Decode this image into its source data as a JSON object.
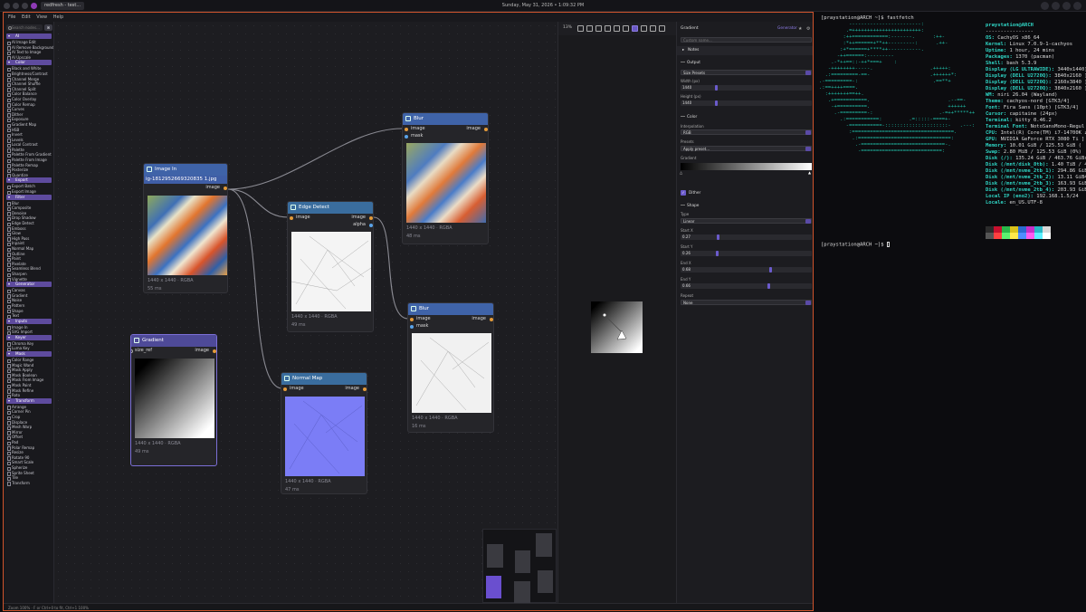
{
  "taskbar": {
    "tab": "redfresh - test...",
    "clock": "Sunday, May 31, 2026 • 1:09:32 PM"
  },
  "menu": [
    "File",
    "Edit",
    "View",
    "Help"
  ],
  "sidebar": {
    "search_placeholder": "Search nodes...",
    "search_btn": "⌘",
    "categories": [
      {
        "name": "AI",
        "items": [
          "AI Image Edit",
          "AI Remove Background",
          "AI Text to Image",
          "AI Upscale"
        ]
      },
      {
        "name": "Color",
        "items": [
          "Black and White",
          "Brightness/Contrast",
          "Channel Merge",
          "Channel Shuffle",
          "Channel Split",
          "Color Balance",
          "Color Overlay",
          "Color Remap",
          "Curves",
          "Dither",
          "Exposure",
          "Gradient Map",
          "HSB",
          "Invert",
          "Levels",
          "Local Contrast",
          "Palette",
          "Palette From Gradient",
          "Palette From Image",
          "Palette Remap",
          "Posterize",
          "Quantize"
        ]
      },
      {
        "name": "Export",
        "items": [
          "Export Batch",
          "Export Image"
        ]
      },
      {
        "name": "Filter",
        "items": [
          "Blur",
          "Composite",
          "Denoise",
          "Drop Shadow",
          "Edge Detect",
          "Emboss",
          "Glow",
          "High Pass",
          "Inpaint",
          "Normal Map",
          "Outline",
          "Paint",
          "Pixelate",
          "Seamless Blend",
          "Sharpen",
          "Vignette"
        ]
      },
      {
        "name": "Generator",
        "items": [
          "Canvas",
          "Gradient",
          "Noise",
          "Pattern",
          "Shape",
          "Text"
        ]
      },
      {
        "name": "Inputs",
        "items": [
          "Image In",
          "SVG Import"
        ]
      },
      {
        "name": "Keyer",
        "items": [
          "Chroma Key",
          "Luma Key"
        ]
      },
      {
        "name": "Mask",
        "items": [
          "Color Range",
          "Magic Wand",
          "Mask Apply",
          "Mask Boolean",
          "Mask From Image",
          "Mask Paint",
          "Mask Refine",
          "Roto"
        ]
      },
      {
        "name": "Transform",
        "items": [
          "Arrange",
          "Corner Pin",
          "Crop",
          "Displace",
          "Mesh Warp",
          "Mirror",
          "Offset",
          "Pad",
          "Polar Remap",
          "Resize",
          "Rotate 90",
          "Smart Scale",
          "Spherize",
          "Sprite Sheet",
          "Tile",
          "Transform"
        ]
      }
    ]
  },
  "status": "Zoom 100% · F or Ctrl+0 to fit, Ctrl+1 100%",
  "nodes": {
    "image_in": {
      "title": "Image In",
      "file": "ig-1812952669320835 1.jpg",
      "out": "image",
      "meta": "1440 x 1440  ·  RGBA",
      "time": "55 ms"
    },
    "gradient": {
      "title": "Gradient",
      "in": "size_ref",
      "out": "image",
      "meta": "1440 x 1440  ·  RGBA",
      "time": "49 ms"
    },
    "edge": {
      "title": "Edge Detect",
      "in": "image",
      "out": "image",
      "out2": "alpha",
      "meta": "1440 x 1440  ·  RGBA",
      "time": "49 ms"
    },
    "blur1": {
      "title": "Blur",
      "in": "image",
      "in2": "mask",
      "out": "image",
      "meta": "1440 x 1440  ·  RGBA",
      "time": "48 ms"
    },
    "normal": {
      "title": "Normal Map",
      "in": "image",
      "out": "image",
      "meta": "1440 x 1440  ·  RGBA",
      "time": "47 ms"
    },
    "blur2": {
      "title": "Blur",
      "in": "image",
      "in2": "mask",
      "out": "image",
      "meta": "1440 x 1440  ·  RGBA",
      "time": "16 ms"
    }
  },
  "preview": {
    "zoom": "13%"
  },
  "props": {
    "title": "Gradient",
    "tag": "Generator",
    "custom_placeholder": "Custom name...",
    "notes": "Notes",
    "output_section": "Output",
    "size_preset": "Size Presets",
    "width_label": "Width (px)",
    "width": "1440",
    "height_label": "Height (px)",
    "height": "1440",
    "color_section": "Color",
    "interp_label": "Interpolation",
    "interp": "RGB",
    "presets_label": "Presets",
    "presets": "Apply preset...",
    "gradient_label": "Gradient",
    "dither": "Dither",
    "shape_section": "Shape",
    "type_label": "Type",
    "type": "Linear",
    "sx_label": "Start X",
    "sx": "0.27",
    "sy_label": "Start Y",
    "sy": "0.26",
    "ex_label": "End X",
    "ex": "0.68",
    "ey_label": "End Y",
    "ey": "0.66",
    "repeat_label": "Repeat",
    "repeat": "None"
  },
  "terminal": {
    "prompt1": "[praystation@ARCH ~]$ fastfetch",
    "prompt2": "[praystation@ARCH ~]$ ",
    "user": "praystation@ARCH",
    "rule": "----------------",
    "info": [
      [
        "OS:",
        "CachyOS x86_64"
      ],
      [
        "Kernel:",
        "Linux 7.0.9-1-cachyos"
      ],
      [
        "Uptime:",
        "1 hour, 24 mins"
      ],
      [
        "Packages:",
        "1370 (pacman)"
      ],
      [
        "Shell:",
        "bash 5.3.9"
      ],
      [
        "Display (LG ULTRAWIDE):",
        "3440x1440]"
      ],
      [
        "Display (DELL U2720Q):",
        "3840x2160 ]"
      ],
      [
        "Display (DELL U2720Q):",
        "2160x3840 ]"
      ],
      [
        "Display (DELL U2720Q):",
        "3840x2160 ]"
      ],
      [
        "WM:",
        "niri 26.04 (Wayland)"
      ],
      [
        "Theme:",
        "cachyos-nord [GTK3/4]"
      ],
      [
        "Font:",
        "Fira Sans (10pt) [GTK3/4]"
      ],
      [
        "Cursor:",
        "capitaine (24px)"
      ],
      [
        "Terminal:",
        "kitty 0.46.2"
      ],
      [
        "Terminal Font:",
        "NotoSansMono-Regul"
      ],
      [
        "CPU:",
        "Intel(R) Core(TM) i7-14700K z"
      ],
      [
        "GPU:",
        "NVIDIA GeForce RTX 3080 Ti ]"
      ],
      [
        "Memory:",
        "10.01 GiB / 125.53 GiB ("
      ],
      [
        "Swap:",
        "2.80 MiB / 125.53 GiB (0%)"
      ],
      [
        "Disk (/):",
        "135.24 GiB / 463.76 GiBs"
      ],
      [
        "Disk (/mnt/disk_8tb):",
        "1.40 TiB / 4"
      ],
      [
        "Disk (/mnt/nvme_2tb_1):",
        "294.86 GiB4"
      ],
      [
        "Disk (/mnt/nvme_2tb_2):",
        "13.11 GiB4"
      ],
      [
        "Disk (/mnt/nvme_2tb_3):",
        "163.93 GiB4"
      ],
      [
        "Disk (/mnt/nvme_2tb_4):",
        "203.93 GiB4"
      ],
      [
        "Local IP (eno2):",
        "192.168.1.5/24"
      ],
      [
        "Locale:",
        "en_US.UTF-8"
      ]
    ],
    "logo": [
      "          ------------------------:",
      "         .=+++++++++++++++++++++++:",
      "        :++============:-------.      :++-",
      "        :*++======+**++---------:      .++-",
      "       :+*======+****++-----------.",
      "      -++======:---------",
      "    .-*++==::-++*===+    :",
      "   -++++++++-----.                   .+++++:",
      "  .:=========-==-                    .++++++*:",
      ".-=========-:                         .==**+",
      ".:==++++====.",
      "  :+++++++==++.",
      "   .+===========.                          .--==-",
      "    -+==========.                          ++++++",
      "     .-=========-:                      .-=++*****++",
      "       .:===========:         .=:::::-====+-",
      "         -===========-:::::::::::::::::::::-   .---:",
      "          :==================================.",
      "           .:===============================:",
      "            .-============================-.",
      "             -===========================:"
    ]
  },
  "palette": [
    "#2b2b2b",
    "#c8102e",
    "#29b84a",
    "#d9c21a",
    "#2a6bd1",
    "#c72fc8",
    "#27b8c4",
    "#d8d8d8",
    "#555555",
    "#ff4040",
    "#5cf070",
    "#ffe84a",
    "#4f8dff",
    "#ff5cf0",
    "#5cf0ff",
    "#ffffff"
  ]
}
